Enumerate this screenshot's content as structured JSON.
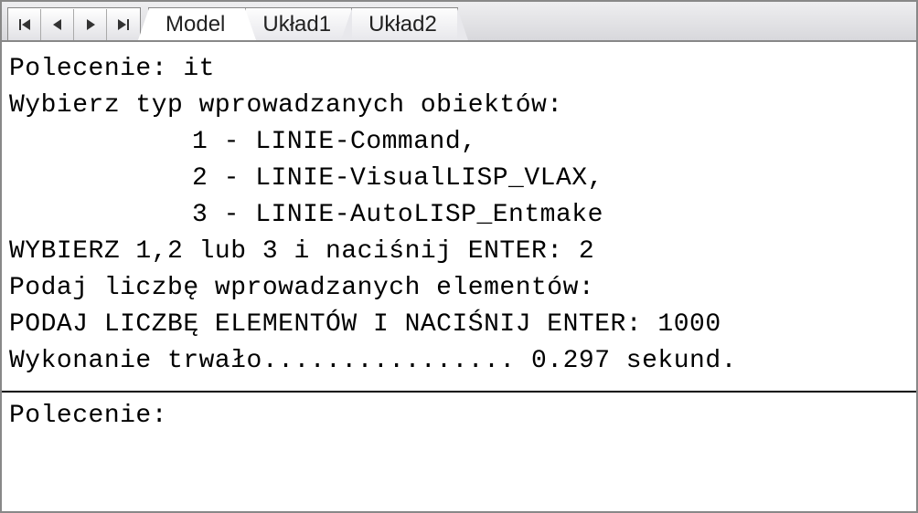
{
  "tabs": {
    "items": [
      {
        "label": "Model",
        "active": true
      },
      {
        "label": "Układ1",
        "active": false
      },
      {
        "label": "Układ2",
        "active": false
      }
    ]
  },
  "cmd": {
    "lines": [
      "Polecenie: it",
      "Wybierz typ wprowadzanych obiektów:",
      "1 - LINIE-Command,",
      "2 - LINIE-VisualLISP_VLAX,",
      "3 - LINIE-AutoLISP_Entmake",
      "WYBIERZ 1,2 lub 3 i naciśnij ENTER: 2",
      "Podaj liczbę wprowadzanych elementów:",
      "PODAJ LICZBĘ ELEMENTÓW I NACIŚNIJ ENTER: 1000",
      "Wykonanie trwało................ 0.297 sekund."
    ],
    "prompt": "Polecenie:"
  }
}
